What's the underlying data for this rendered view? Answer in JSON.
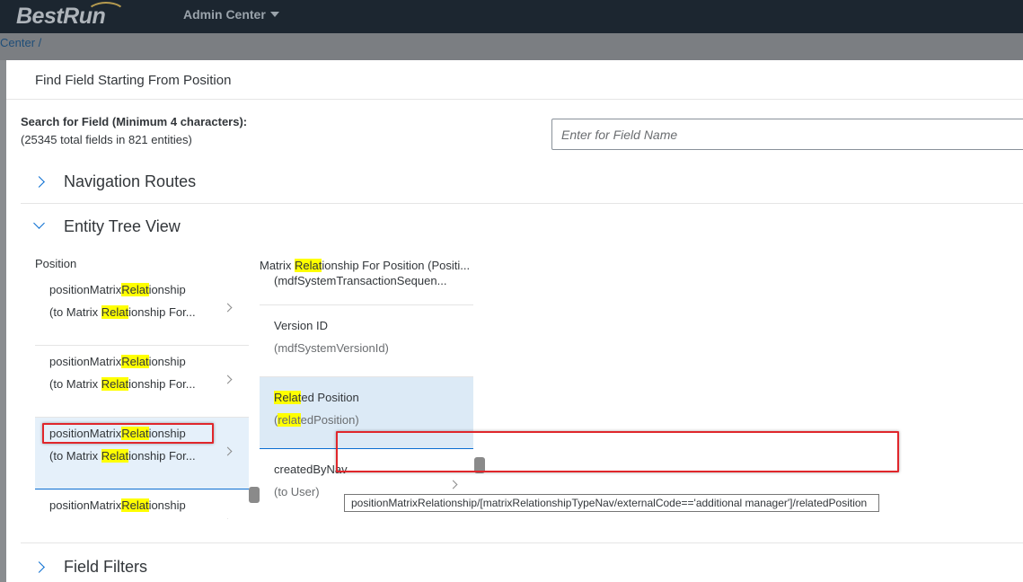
{
  "shell": {
    "logo": "BestRun",
    "app_title": "Admin Center",
    "breadcrumb": "Center /"
  },
  "dialog": {
    "title": "Find Field Starting From Position",
    "search": {
      "label": "Search for Field (Minimum 4 characters):",
      "subtitle": "(25345 total fields in 821 entities)",
      "placeholder": "Enter for Field Name",
      "value": ""
    },
    "panels": {
      "navigation": "Navigation Routes",
      "entity_tree": "Entity Tree View",
      "field_filters": "Field Filters"
    },
    "left_column": {
      "title": "Position",
      "items": [
        {
          "l1_a": "positionMatrix",
          "l1_hl": "Relat",
          "l1_b": "ionship",
          "l2_a": "(to Matrix ",
          "l2_hl": "Relat",
          "l2_b": "ionship For...",
          "selected": false
        },
        {
          "l1_a": "positionMatrix",
          "l1_hl": "Relat",
          "l1_b": "ionship",
          "l2_a": "(to Matrix ",
          "l2_hl": "Relat",
          "l2_b": "ionship For...",
          "selected": false
        },
        {
          "l1_a": "positionMatrix",
          "l1_hl": "Relat",
          "l1_b": "ionship",
          "l2_a": "(to Matrix ",
          "l2_hl": "Relat",
          "l2_b": "ionship For...",
          "selected": true
        },
        {
          "l1_a": "positionMatrix",
          "l1_hl": "Relat",
          "l1_b": "ionship",
          "l2_a": "",
          "l2_hl": "",
          "l2_b": "",
          "selected": false
        }
      ]
    },
    "right_column": {
      "items": [
        {
          "l1_a": "Matrix ",
          "l1_hl": "Relat",
          "l1_b": "ionship For Position (Positi...",
          "l2_a": "(mdfSystemTransactionSequen...",
          "l2_hl": "",
          "l2_b": "",
          "selected": false
        },
        {
          "l1_a": "Version ID",
          "l1_hl": "",
          "l1_b": "",
          "l2_a": "(mdfSystemVersionId)",
          "l2_hl": "",
          "l2_b": "",
          "selected": false
        },
        {
          "l1_a": "",
          "l1_hl": "Relat",
          "l1_b": "ed Position",
          "l2_a": "(",
          "l2_hl": "relat",
          "l2_b": "edPosition)",
          "selected": true
        },
        {
          "l1_a": "createdByNav",
          "l1_hl": "",
          "l1_b": "",
          "l2_a": "(to User)",
          "l2_hl": "",
          "l2_b": "",
          "selected": false
        }
      ]
    },
    "tooltip": "positionMatrixRelationship/[matrixRelationshipTypeNav/externalCode=='additional manager']/relatedPosition"
  },
  "colors": {
    "shell_bg": "#1c2630",
    "highlight": "#ffff00",
    "selected_bg": "#e5f0fa",
    "accent": "#0a6ed1",
    "annotation": "#e0262b"
  }
}
